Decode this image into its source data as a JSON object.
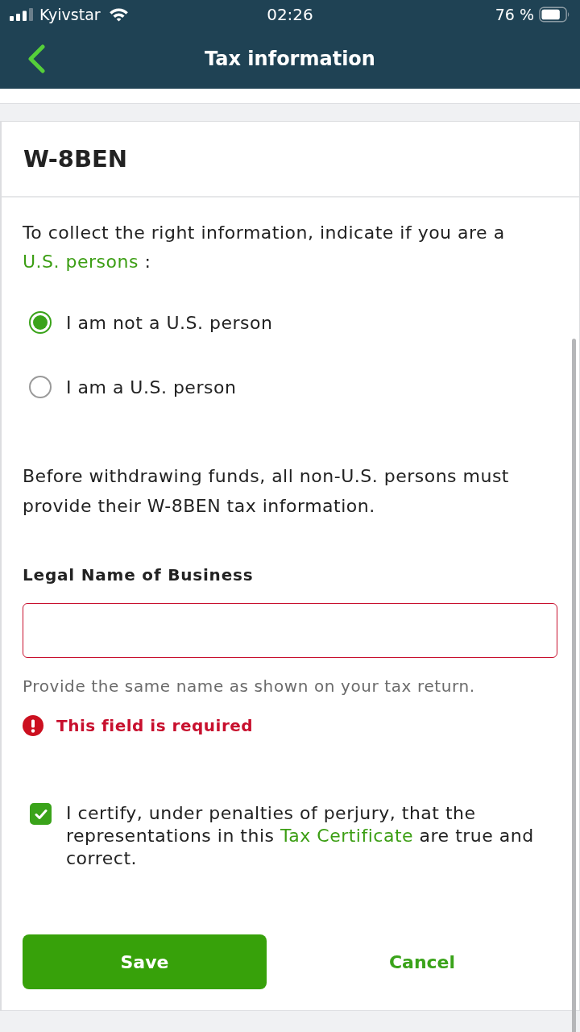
{
  "status_bar": {
    "carrier": "Kyivstar",
    "time": "02:26",
    "battery": "76 %"
  },
  "header": {
    "title": "Tax information"
  },
  "form": {
    "title": "W-8BEN",
    "intro": {
      "text": "To collect the right information, indicate if you are a",
      "link": "U.S. persons",
      "suffix": ":"
    },
    "options": [
      {
        "label": "I am not a U.S. person",
        "selected": true
      },
      {
        "label": "I am a U.S. person",
        "selected": false
      }
    ],
    "notice": "Before withdrawing funds, all non-U.S. persons must provide their W-8BEN tax information.",
    "field": {
      "label": "Legal Name of Business",
      "hint": "Provide the same name as shown on your tax return.",
      "error": "This field is required"
    },
    "certification": {
      "checked": true,
      "text": "I certify, under penalties of perjury, that the representations in this",
      "link": "Tax Certificate",
      "suffix": "are true and correct."
    },
    "buttons": [
      {
        "label": "Save",
        "kind": "primary"
      },
      {
        "label": "Cancel",
        "kind": "text"
      }
    ]
  }
}
